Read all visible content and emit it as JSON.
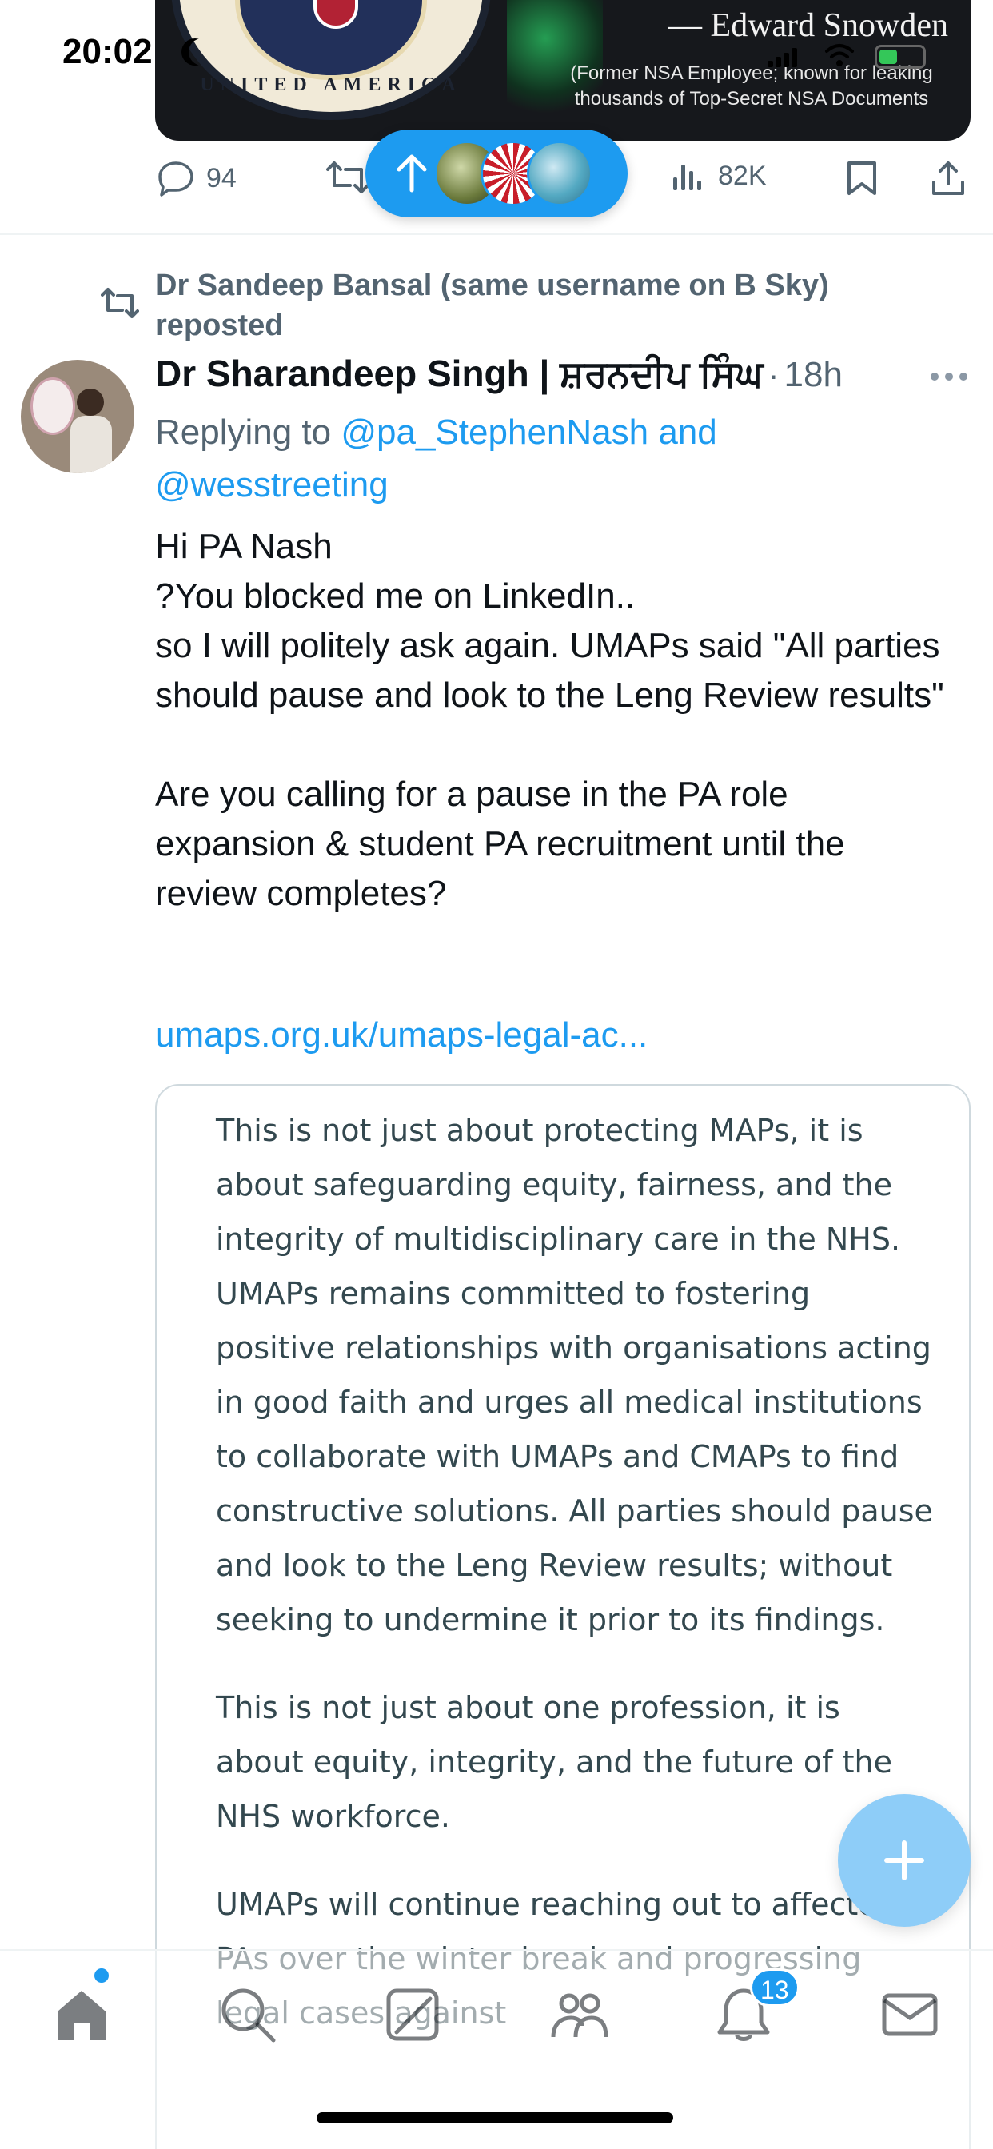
{
  "status_bar": {
    "time": "20:02"
  },
  "media": {
    "seal_text": "UNITED AMERICA",
    "quote_author": "— Edward Snowden",
    "caption_line1": "(Former NSA Employee; known for leaking",
    "caption_line2": "thousands of Top-Secret NSA Documents"
  },
  "prev_tweet_actions": {
    "replies": "94",
    "views": "82K"
  },
  "repost_header": {
    "text": "Dr Sandeep Bansal (same username on B Sky) reposted"
  },
  "tweet": {
    "display_name": "Dr Sharandeep Singh | ਸ਼ਰਨਦੀਪ ਸਿੰਘ",
    "separator": "·",
    "time_ago": "18h",
    "replying_prefix": "Replying to",
    "replying_mentions": "@pa_StephenNash and @wesstreeting",
    "body_paragraph1": "Hi PA Nash\n?You blocked me on LinkedIn..\nso I will politely ask again. UMAPs said \"All parties should pause and look to the Leng Review results\"",
    "body_paragraph2": "Are you calling for a pause in the PA role expansion &  student PA recruitment until the review completes?",
    "link": "umaps.org.uk/umaps-legal-ac..."
  },
  "quote": {
    "paragraph1": "This is not just about protecting MAPs, it is about safeguarding equity, fairness, and the integrity of multidisciplinary care in the NHS. UMAPs remains committed to fostering positive relationships with organisations acting in good faith and urges all medical institutions to collaborate with UMAPs and CMAPs to find constructive solutions. All parties should pause and look to the Leng Review results; without seeking to undermine it prior to its findings.",
    "paragraph2": "This is not just about one profession, it is about equity, integrity, and the future of the NHS workforce.",
    "paragraph3": "UMAPs will continue reaching out to affected PAs over the winter break and progressing legal cases against"
  },
  "bottom_nav": {
    "notifications_badge": "13"
  },
  "colors": {
    "accent": "#1d9bf0",
    "muted_text": "#536471",
    "quote_text": "#33484f"
  }
}
